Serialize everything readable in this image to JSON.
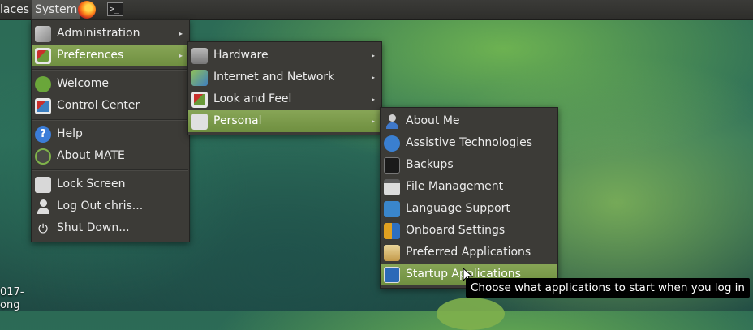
{
  "panel": {
    "places_label": "laces",
    "system_label": "System",
    "firefox_icon": "firefox-icon",
    "terminal_icon": "terminal-icon",
    "terminal_glyph": ">_"
  },
  "system_menu": {
    "items": [
      {
        "label": "Administration",
        "icon": "administration-icon"
      },
      {
        "label": "Preferences",
        "icon": "preferences-icon"
      },
      {
        "label": "Welcome",
        "icon": "welcome-icon"
      },
      {
        "label": "Control Center",
        "icon": "control-center-icon"
      },
      {
        "label": "Help",
        "icon": "help-icon",
        "glyph": "?"
      },
      {
        "label": "About MATE",
        "icon": "mate-icon"
      },
      {
        "label": "Lock Screen",
        "icon": "lock-icon"
      },
      {
        "label": "Log Out chris...",
        "icon": "user-icon"
      },
      {
        "label": "Shut Down...",
        "icon": "power-icon",
        "glyph": "⏻"
      }
    ]
  },
  "preferences_menu": {
    "items": [
      {
        "label": "Hardware",
        "icon": "hardware-icon"
      },
      {
        "label": "Internet and Network",
        "icon": "network-icon"
      },
      {
        "label": "Look and Feel",
        "icon": "look-and-feel-icon"
      },
      {
        "label": "Personal",
        "icon": "personal-icon"
      }
    ]
  },
  "personal_menu": {
    "items": [
      {
        "label": "About Me",
        "icon": "about-me-icon"
      },
      {
        "label": "Assistive Technologies",
        "icon": "accessibility-icon"
      },
      {
        "label": "Backups",
        "icon": "backups-icon"
      },
      {
        "label": "File Management",
        "icon": "file-management-icon"
      },
      {
        "label": "Language Support",
        "icon": "language-icon"
      },
      {
        "label": "Onboard Settings",
        "icon": "onboard-icon"
      },
      {
        "label": "Preferred Applications",
        "icon": "preferred-apps-icon"
      },
      {
        "label": "Startup Applications",
        "icon": "startup-apps-icon"
      }
    ]
  },
  "submenu_arrow": "▸",
  "tooltip": "Choose what applications to start when you log in",
  "desktop": {
    "icon_label_line1": "017-",
    "icon_label_line2": "ong"
  },
  "colors": {
    "menu_bg": "#3c3b37",
    "highlight": "#7b9b4a",
    "panel_bg": "#34342f"
  }
}
